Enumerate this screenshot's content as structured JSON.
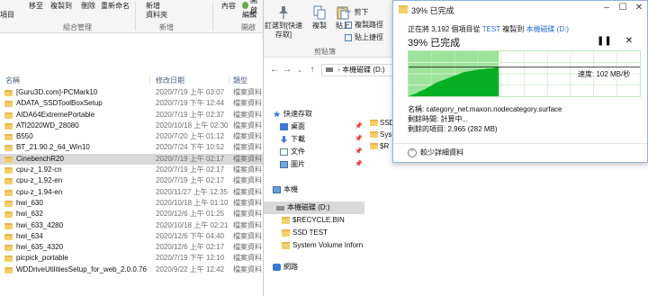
{
  "left_ribbon": {
    "items": [
      "移至",
      "複製到",
      "刪除",
      "重新命名",
      "新增",
      "資料夾",
      "內容",
      "開啟"
    ],
    "sub_items": [
      "項目",
      "編輯"
    ],
    "groups": [
      "組合管理",
      "新增",
      "開啟"
    ]
  },
  "left_columns": {
    "name": "名稱",
    "date": "修改日期",
    "type": "類型"
  },
  "left_files": [
    {
      "name": "[Guru3D.com]-PCMark10",
      "date": "2020/7/19 上午 03:07",
      "type": "檔案資料"
    },
    {
      "name": "ADATA_SSDToolBoxSetup",
      "date": "2020/7/19 下午 12:44",
      "type": "檔案資料"
    },
    {
      "name": "AIDA64ExtremePortable",
      "date": "2020/7/19 上午 02:37",
      "type": "檔案資料"
    },
    {
      "name": "ATI2020WD_28080",
      "date": "2020/10/18 上午 02:30",
      "type": "檔案資料"
    },
    {
      "name": "B550",
      "date": "2020/7/20 上午 01:12",
      "type": "檔案資料"
    },
    {
      "name": "BT_21.90.2_64_Win10",
      "date": "2020/7/24 下午 10:52",
      "type": "檔案資料"
    },
    {
      "name": "CinebenchR20",
      "date": "2020/7/19 上午 02:17",
      "type": "檔案資料"
    },
    {
      "name": "cpu-z_1.92-cn",
      "date": "2020/7/19 上午 02:17",
      "type": "檔案資料"
    },
    {
      "name": "cpu-z_1.92-en",
      "date": "2020/7/19 上午 02:17",
      "type": "檔案資料"
    },
    {
      "name": "cpu-z_1.94-en",
      "date": "2020/11/27 上午 12:35",
      "type": "檔案資料"
    },
    {
      "name": "hwi_630",
      "date": "2020/10/18 上午 01:10",
      "type": "檔案資料"
    },
    {
      "name": "hwi_632",
      "date": "2020/12/6 上午 01:25",
      "type": "檔案資料"
    },
    {
      "name": "hwi_633_4280",
      "date": "2020/10/18 上午 02:21",
      "type": "檔案資料"
    },
    {
      "name": "hwi_634",
      "date": "2020/12/6 下午 04:40",
      "type": "檔案資料"
    },
    {
      "name": "hwi_635_4320",
      "date": "2020/12/6 上午 02:17",
      "type": "檔案資料"
    },
    {
      "name": "picpick_portable",
      "date": "2020/7/19 下午 12:10",
      "type": "檔案資料"
    },
    {
      "name": "WDDriveUtilitiesSetup_for_web_2.0.0.76",
      "date": "2020/9/22 上午 12:42",
      "type": "檔案資料"
    }
  ],
  "left_selected_index": 6,
  "mid_ribbon": {
    "pin_label": "釘選到[快速存取]",
    "copy_label": "複製",
    "paste_label": "貼上",
    "cut_label": "剪下",
    "copy_path_label": "複製路徑",
    "paste_shortcut_label": "貼上捷徑",
    "group_label": "剪貼簿"
  },
  "mid_address": "本機磁碟 (D:)",
  "mid_nav": [
    {
      "label": "快速存取",
      "icon": "star-icon",
      "pinned": false
    },
    {
      "label": "桌面",
      "icon": "desktop-icon",
      "pinned": true
    },
    {
      "label": "下載",
      "icon": "download-icon",
      "pinned": true
    },
    {
      "label": "文件",
      "icon": "document-icon",
      "pinned": true
    },
    {
      "label": "圖片",
      "icon": "picture-icon",
      "pinned": true
    },
    {
      "label": "本機",
      "icon": "computer-icon",
      "pinned": false
    },
    {
      "label": "本機磁碟 (D:)",
      "icon": "drive-icon",
      "pinned": false
    },
    {
      "label": "$RECYCLE.BIN",
      "icon": "folder-icon",
      "pinned": false
    },
    {
      "label": "SSD TEST",
      "icon": "folder-icon",
      "pinned": false
    },
    {
      "label": "System Volume Inforn",
      "icon": "folder-icon",
      "pinned": false
    },
    {
      "label": "網路",
      "icon": "network-icon",
      "pinned": false
    }
  ],
  "mid_files": [
    "SSD",
    "Sys",
    "$R"
  ],
  "dialog": {
    "title": "39% 已完成",
    "line_prefix": "正在將 3,192 個項目從 ",
    "source": "TEST",
    "line_mid": " 複製到 ",
    "dest": "本機磁碟 (D:)",
    "percent_text": "39% 已完成",
    "pause_glyph": "❚❚",
    "cancel_glyph": "✕",
    "speed": "速度: 102 MB/秒",
    "progress": 0.39,
    "speed_series": [
      0.0,
      0.02,
      0.04,
      0.07,
      0.09,
      0.12,
      0.15,
      0.18,
      0.2,
      0.22,
      0.24,
      0.26,
      0.28,
      0.3,
      0.32,
      0.33,
      0.34,
      0.35,
      0.36,
      0.36,
      0.37,
      0.37,
      0.38,
      0.39
    ],
    "name_line": "名稱: category_net.maxon.nodecategory.surface",
    "time_line": "剩餘時間: 計算中...",
    "items_line": "剩餘的項目: 2,965 (282 MB)",
    "less_details": "較少詳細資料",
    "colors": {
      "graph_fill": "#06b025",
      "graph_bg_done": "#9ce39b",
      "link": "#2b6fd1"
    }
  }
}
